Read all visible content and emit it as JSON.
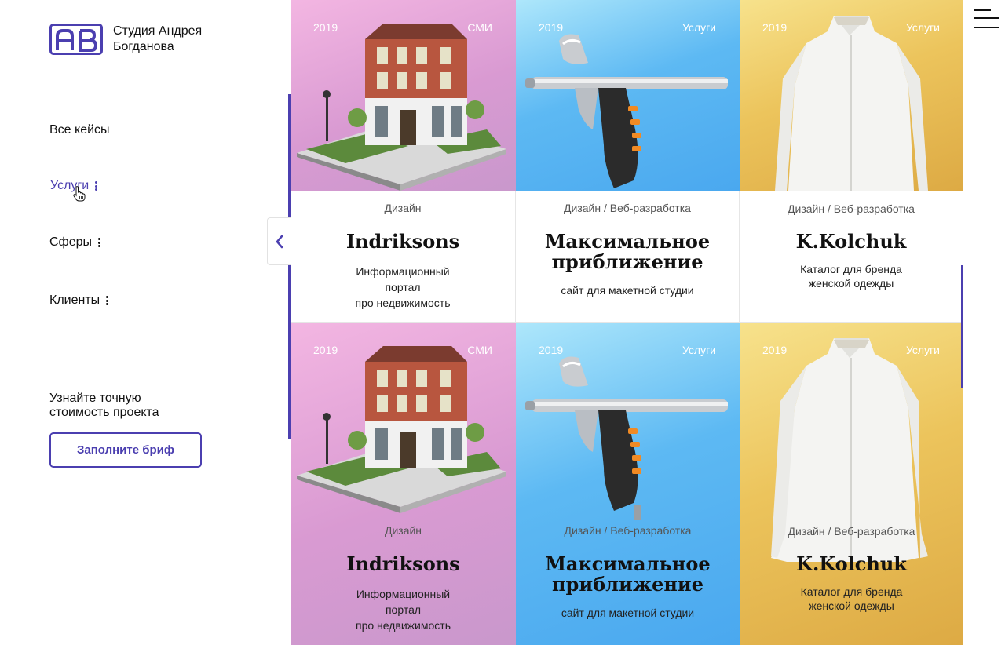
{
  "brand": {
    "logo_letters": "AB",
    "name_line1": "Студия Андрея",
    "name_line2": "Богданова",
    "accent_color": "#4b3fb0"
  },
  "nav": {
    "items": [
      {
        "label": "Все кейсы",
        "has_dots": false,
        "active": false
      },
      {
        "label": "Услуги",
        "has_dots": true,
        "active": true
      },
      {
        "label": "Сферы",
        "has_dots": true,
        "active": false
      },
      {
        "label": "Клиенты",
        "has_dots": true,
        "active": false
      }
    ]
  },
  "cta": {
    "text_line1": "Узнайте точную",
    "text_line2": "стоимость проекта",
    "button_label": "Заполните бриф"
  },
  "icons": {
    "collapse": "chevron-left-icon",
    "menu": "hamburger-menu-icon",
    "cursor": "hand-pointer-icon"
  },
  "cards": [
    {
      "year": "2019",
      "tag": "СМИ",
      "category": "Дизайн",
      "title_line1": "Indriksons",
      "title_line2": "",
      "desc_line1": "Информационный портал",
      "desc_line2": "про недвижимость",
      "image": "house-image",
      "theme": "pink"
    },
    {
      "year": "2019",
      "tag": "Услуги",
      "category": "Дизайн / Веб-разработка",
      "title_line1": "Максимальное",
      "title_line2": "приближение",
      "desc_line1": "сайт для макетной студии",
      "desc_line2": "",
      "image": "airbrush-image",
      "theme": "blue"
    },
    {
      "year": "2019",
      "tag": "Услуги",
      "category": "Дизайн / Веб-разработка",
      "title_line1": "K.Kolchuk",
      "title_line2": "",
      "desc_line1": "Каталог для бренда",
      "desc_line2": "женской одежды",
      "image": "white-shirt-image",
      "theme": "gold"
    },
    {
      "year": "2019",
      "tag": "СМИ",
      "category": "Дизайн",
      "title_line1": "Indriksons",
      "title_line2": "",
      "desc_line1": "Информационный портал",
      "desc_line2": "про недвижимость",
      "image": "house-image",
      "theme": "pink"
    },
    {
      "year": "2019",
      "tag": "Услуги",
      "category": "Дизайн / Веб-разработка",
      "title_line1": "Максимальное",
      "title_line2": "приближение",
      "desc_line1": "сайт для макетной студии",
      "desc_line2": "",
      "image": "airbrush-image",
      "theme": "blue"
    },
    {
      "year": "2019",
      "tag": "Услуги",
      "category": "Дизайн / Веб-разработка",
      "title_line1": "K.Kolchuk",
      "title_line2": "",
      "desc_line1": "Каталог для бренда",
      "desc_line2": "женской одежды",
      "image": "white-shirt-image",
      "theme": "gold"
    }
  ]
}
